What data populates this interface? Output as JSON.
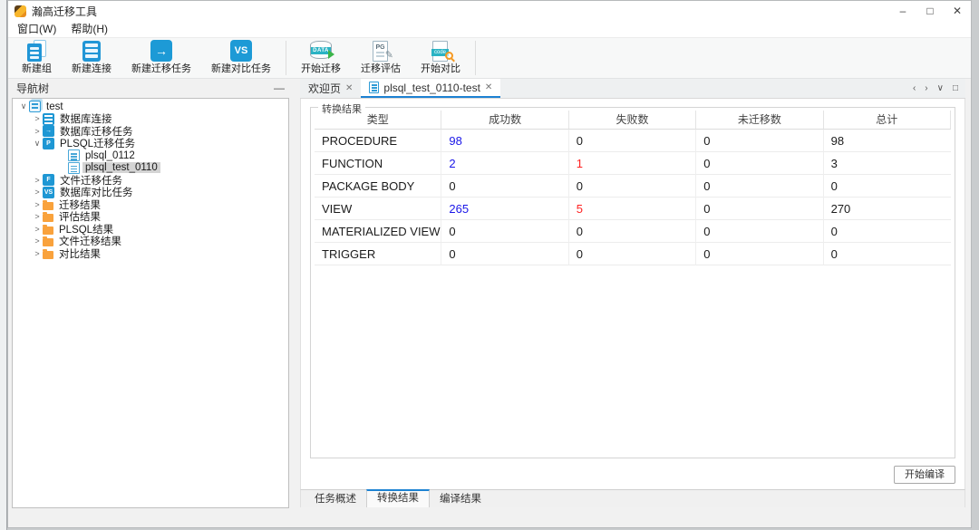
{
  "window": {
    "title": "瀚高迁移工具",
    "minimize": "–",
    "maximize": "□",
    "close": "✕"
  },
  "menu": {
    "items": [
      {
        "label": "窗口(W)"
      },
      {
        "label": "帮助(H)"
      }
    ]
  },
  "toolbar": {
    "buttons": [
      {
        "label": "新建组",
        "icon": "new-group-icon"
      },
      {
        "label": "新建连接",
        "icon": "new-connection-icon"
      },
      {
        "label": "新建迁移任务",
        "icon": "new-migration-task-icon"
      },
      {
        "label": "新建对比任务",
        "icon": "new-compare-task-icon"
      },
      {
        "label": "开始迁移",
        "icon": "start-migration-icon"
      },
      {
        "label": "迁移评估",
        "icon": "migration-assess-icon"
      },
      {
        "label": "开始对比",
        "icon": "start-compare-icon"
      }
    ],
    "glyphs": {
      "arrow": "→",
      "vs": "VS",
      "data": "DATA",
      "pg": "PG",
      "code": "code",
      "pencil": "✎"
    }
  },
  "nav": {
    "title": "导航树",
    "collapse": "—",
    "tree": [
      {
        "label": "test",
        "cls": "d0",
        "exp": "∨",
        "icon": "ic-group",
        "glyph": ""
      },
      {
        "label": "数据库连接",
        "cls": "d1",
        "exp": ">",
        "icon": "ic-server",
        "glyph": ""
      },
      {
        "label": "数据库迁移任务",
        "cls": "d1",
        "exp": ">",
        "icon": "ic-sq",
        "glyph": "→"
      },
      {
        "label": "PLSQL迁移任务",
        "cls": "d1",
        "exp": "∨",
        "icon": "ic-sq",
        "glyph": "P"
      },
      {
        "label": "plsql_0112",
        "cls": "d2",
        "exp": "",
        "icon": "ic-doc",
        "glyph": ""
      },
      {
        "label": "plsql_test_0110",
        "cls": "d2 selected",
        "exp": "",
        "icon": "ic-doc",
        "glyph": ""
      },
      {
        "label": "文件迁移任务",
        "cls": "d1",
        "exp": ">",
        "icon": "ic-sq",
        "glyph": "F"
      },
      {
        "label": "数据库对比任务",
        "cls": "d1",
        "exp": ">",
        "icon": "ic-sq",
        "glyph": "VS"
      },
      {
        "label": "迁移结果",
        "cls": "d1",
        "exp": ">",
        "icon": "ic-folder",
        "glyph": ""
      },
      {
        "label": "评估结果",
        "cls": "d1",
        "exp": ">",
        "icon": "ic-folder",
        "glyph": ""
      },
      {
        "label": "PLSQL结果",
        "cls": "d1",
        "exp": ">",
        "icon": "ic-folder",
        "glyph": ""
      },
      {
        "label": "文件迁移结果",
        "cls": "d1",
        "exp": ">",
        "icon": "ic-folder",
        "glyph": ""
      },
      {
        "label": "对比结果",
        "cls": "d1",
        "exp": ">",
        "icon": "ic-folder",
        "glyph": ""
      }
    ]
  },
  "editor": {
    "tabs": [
      {
        "label": "欢迎页",
        "close": "✕"
      },
      {
        "label": "plsql_test_0110-test",
        "close": "✕"
      }
    ],
    "tab_controls": {
      "prev": "‹",
      "next": "›",
      "list": "∨",
      "maximize": "□"
    }
  },
  "result": {
    "groupbox_title": "转换结果",
    "table": {
      "headers": [
        "类型",
        "成功数",
        "失败数",
        "未迁移数",
        "总计"
      ],
      "rows": [
        {
          "cells": [
            {
              "t": "PROCEDURE"
            },
            {
              "t": "98",
              "cls": "v-blue"
            },
            {
              "t": "0"
            },
            {
              "t": "0"
            },
            {
              "t": "98"
            }
          ]
        },
        {
          "cells": [
            {
              "t": "FUNCTION"
            },
            {
              "t": "2",
              "cls": "v-blue"
            },
            {
              "t": "1",
              "cls": "v-red"
            },
            {
              "t": "0"
            },
            {
              "t": "3"
            }
          ]
        },
        {
          "cells": [
            {
              "t": "PACKAGE BODY"
            },
            {
              "t": "0"
            },
            {
              "t": "0"
            },
            {
              "t": "0"
            },
            {
              "t": "0"
            }
          ]
        },
        {
          "cells": [
            {
              "t": "VIEW"
            },
            {
              "t": "265",
              "cls": "v-blue"
            },
            {
              "t": "5",
              "cls": "v-red"
            },
            {
              "t": "0"
            },
            {
              "t": "270"
            }
          ]
        },
        {
          "cells": [
            {
              "t": "MATERIALIZED VIEW"
            },
            {
              "t": "0"
            },
            {
              "t": "0"
            },
            {
              "t": "0"
            },
            {
              "t": "0"
            }
          ]
        },
        {
          "cells": [
            {
              "t": "TRIGGER"
            },
            {
              "t": "0"
            },
            {
              "t": "0"
            },
            {
              "t": "0"
            },
            {
              "t": "0"
            }
          ]
        }
      ]
    },
    "compile_button": "开始编译",
    "bottom_tabs": [
      {
        "label": "任务概述",
        "cls": ""
      },
      {
        "label": "转换结果",
        "cls": "active"
      },
      {
        "label": "编译结果",
        "cls": ""
      }
    ]
  },
  "colors": {
    "accent_blue": "#1d82d2",
    "icon_blue": "#1e97d4",
    "folder_orange": "#f9a23c",
    "value_blue": "#1a16e8",
    "value_red": "#ff2222",
    "teal_band": "#2ab3c4",
    "go_green": "#3cb54a",
    "magnifier_orange": "#f59a23"
  }
}
